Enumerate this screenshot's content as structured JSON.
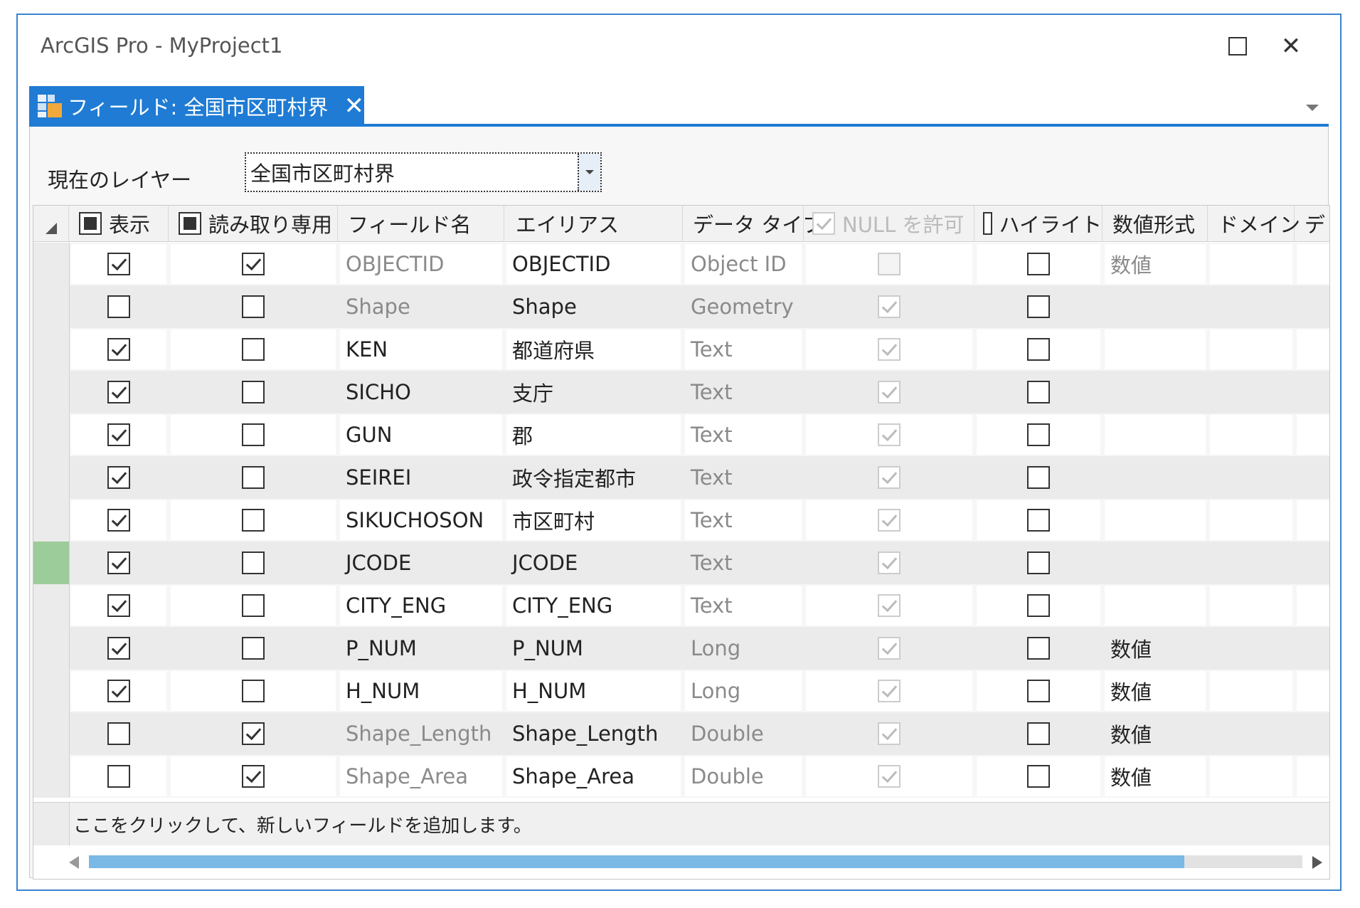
{
  "window": {
    "title": "ArcGIS Pro - MyProject1"
  },
  "tab": {
    "label": "フィールド:  全国市区町村界",
    "close": "✕"
  },
  "layer": {
    "label": "現在のレイヤー",
    "value": "全国市区町村界"
  },
  "columns": {
    "visible": "表示",
    "readonly": "読み取り専用",
    "field_name": "フィールド名",
    "alias": "エイリアス",
    "data_type": "データ タイプ",
    "allow_null": "NULL を許可",
    "highlight": "ハイライト",
    "number_format": "数値形式",
    "domain": "ドメイン",
    "default": "デ"
  },
  "rows": [
    {
      "visible": true,
      "readonly": true,
      "field_name": "OBJECTID",
      "name_gray": true,
      "alias": "OBJECTID",
      "type": "Object ID",
      "null": false,
      "null_disabled_empty": true,
      "highlight": false,
      "number_format": "数値",
      "format_gray": true
    },
    {
      "visible": false,
      "readonly": false,
      "field_name": "Shape",
      "name_gray": true,
      "alias": "Shape",
      "type": "Geometry",
      "null": true,
      "highlight": false,
      "number_format": ""
    },
    {
      "visible": true,
      "readonly": false,
      "field_name": "KEN",
      "name_gray": false,
      "alias": "都道府県",
      "type": "Text",
      "null": true,
      "highlight": false,
      "number_format": ""
    },
    {
      "visible": true,
      "readonly": false,
      "field_name": "SICHO",
      "name_gray": false,
      "alias": "支庁",
      "type": "Text",
      "null": true,
      "highlight": false,
      "number_format": ""
    },
    {
      "visible": true,
      "readonly": false,
      "field_name": "GUN",
      "name_gray": false,
      "alias": "郡",
      "type": "Text",
      "null": true,
      "highlight": false,
      "number_format": ""
    },
    {
      "visible": true,
      "readonly": false,
      "field_name": "SEIREI",
      "name_gray": false,
      "alias": "政令指定都市",
      "type": "Text",
      "null": true,
      "highlight": false,
      "number_format": ""
    },
    {
      "visible": true,
      "readonly": false,
      "field_name": "SIKUCHOSON",
      "name_gray": false,
      "alias": "市区町村",
      "type": "Text",
      "null": true,
      "highlight": false,
      "number_format": ""
    },
    {
      "visible": true,
      "readonly": false,
      "field_name": "JCODE",
      "name_gray": false,
      "alias": "JCODE",
      "type": "Text",
      "null": true,
      "highlight": false,
      "number_format": "",
      "selected": true
    },
    {
      "visible": true,
      "readonly": false,
      "field_name": "CITY_ENG",
      "name_gray": false,
      "alias": "CITY_ENG",
      "type": "Text",
      "null": true,
      "highlight": false,
      "number_format": ""
    },
    {
      "visible": true,
      "readonly": false,
      "field_name": "P_NUM",
      "name_gray": false,
      "alias": "P_NUM",
      "type": "Long",
      "null": true,
      "highlight": false,
      "number_format": "数値"
    },
    {
      "visible": true,
      "readonly": false,
      "field_name": "H_NUM",
      "name_gray": false,
      "alias": "H_NUM",
      "type": "Long",
      "null": true,
      "highlight": false,
      "number_format": "数値"
    },
    {
      "visible": false,
      "readonly": true,
      "field_name": "Shape_Length",
      "name_gray": true,
      "alias": "Shape_Length",
      "type": "Double",
      "null": true,
      "highlight": false,
      "number_format": "数値"
    },
    {
      "visible": false,
      "readonly": true,
      "field_name": "Shape_Area",
      "name_gray": true,
      "alias": "Shape_Area",
      "type": "Double",
      "null": true,
      "highlight": false,
      "number_format": "数値"
    }
  ],
  "add_field_text": "ここをクリックして、新しいフィールドを追加します。",
  "colors": {
    "accent": "#1f7bd3",
    "selected_row_marker": "#9ccc9a",
    "scroll_thumb": "#7ab8e6"
  }
}
